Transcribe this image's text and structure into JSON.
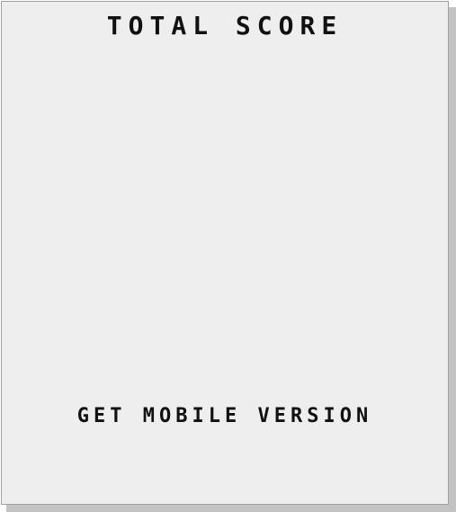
{
  "panel": {
    "title": "TOTAL SCORE",
    "mobile_link_label": "GET MOBILE VERSION"
  },
  "colors": {
    "panel_background": "#eeeeee",
    "shadow": "#c3c3c3",
    "border": "#a0a0a0",
    "text": "#111111"
  }
}
